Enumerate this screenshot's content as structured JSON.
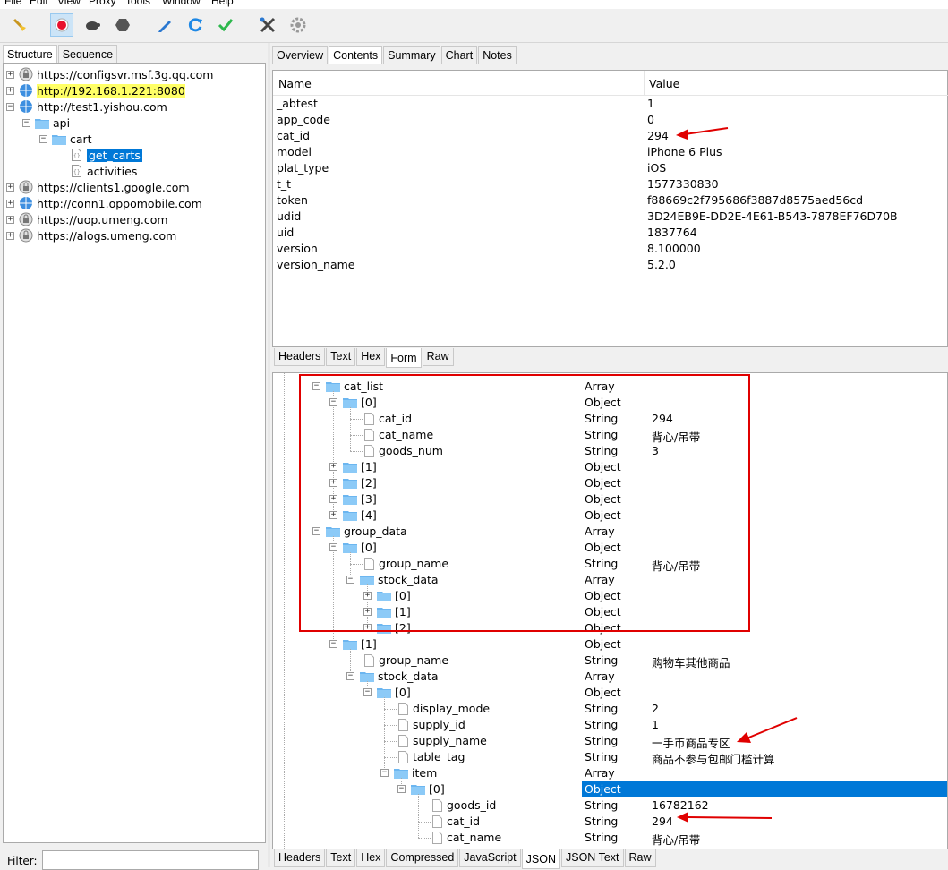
{
  "menu": [
    "File",
    "Edit",
    "View",
    "Proxy",
    "Tools",
    "Window",
    "Help"
  ],
  "left_tabs": [
    "Structure",
    "Sequence"
  ],
  "tree": [
    {
      "label": "https://configsvr.msf.3g.qq.com",
      "type": "lock"
    },
    {
      "label": "http://192.168.1.221:8080",
      "type": "http",
      "highlight": true
    },
    {
      "label": "http://test1.yishou.com",
      "type": "http"
    },
    {
      "label": "api",
      "type": "folder"
    },
    {
      "label": "cart",
      "type": "folder"
    },
    {
      "label": "get_carts",
      "type": "doc",
      "selected": true
    },
    {
      "label": "activities",
      "type": "doc"
    },
    {
      "label": "https://clients1.google.com",
      "type": "lock"
    },
    {
      "label": "http://conn1.oppomobile.com",
      "type": "http"
    },
    {
      "label": "https://uop.umeng.com",
      "type": "lock"
    },
    {
      "label": "https://alogs.umeng.com",
      "type": "lock"
    }
  ],
  "filter_label": "Filter:",
  "top_tabs": [
    "Overview",
    "Contents",
    "Summary",
    "Chart",
    "Notes"
  ],
  "grid": {
    "headers": [
      "Name",
      "Value"
    ],
    "rows": [
      [
        "_abtest",
        "1"
      ],
      [
        "app_code",
        "0"
      ],
      [
        "cat_id",
        "294"
      ],
      [
        "model",
        "iPhone 6 Plus"
      ],
      [
        "plat_type",
        "iOS"
      ],
      [
        "t_t",
        "1577330830"
      ],
      [
        "token",
        "f88669c2f795686f3887d8575aed56cd"
      ],
      [
        "udid",
        "3D24EB9E-DD2E-4E61-B543-7878EF76D70B"
      ],
      [
        "uid",
        "1837764"
      ],
      [
        "version",
        "8.100000"
      ],
      [
        "version_name",
        "5.2.0"
      ]
    ]
  },
  "mid_tabs": [
    "Headers",
    "Text",
    "Hex",
    "Form",
    "Raw"
  ],
  "json_rows": [
    {
      "name": "cat_list",
      "type": "Array",
      "value": ""
    },
    {
      "name": "[0]",
      "type": "Object",
      "value": ""
    },
    {
      "name": "cat_id",
      "type": "String",
      "value": "294"
    },
    {
      "name": "cat_name",
      "type": "String",
      "value": "背心/吊带"
    },
    {
      "name": "goods_num",
      "type": "String",
      "value": "3"
    },
    {
      "name": "[1]",
      "type": "Object",
      "value": ""
    },
    {
      "name": "[2]",
      "type": "Object",
      "value": ""
    },
    {
      "name": "[3]",
      "type": "Object",
      "value": ""
    },
    {
      "name": "[4]",
      "type": "Object",
      "value": ""
    },
    {
      "name": "group_data",
      "type": "Array",
      "value": ""
    },
    {
      "name": "[0]",
      "type": "Object",
      "value": ""
    },
    {
      "name": "group_name",
      "type": "String",
      "value": "背心/吊带"
    },
    {
      "name": "stock_data",
      "type": "Array",
      "value": ""
    },
    {
      "name": "[0]",
      "type": "Object",
      "value": ""
    },
    {
      "name": "[1]",
      "type": "Object",
      "value": ""
    },
    {
      "name": "[2]",
      "type": "Object",
      "value": ""
    },
    {
      "name": "[1]",
      "type": "Object",
      "value": ""
    },
    {
      "name": "group_name",
      "type": "String",
      "value": "购物车其他商品"
    },
    {
      "name": "stock_data",
      "type": "Array",
      "value": ""
    },
    {
      "name": "[0]",
      "type": "Object",
      "value": ""
    },
    {
      "name": "display_mode",
      "type": "String",
      "value": "2"
    },
    {
      "name": "supply_id",
      "type": "String",
      "value": "1"
    },
    {
      "name": "supply_name",
      "type": "String",
      "value": "一手币商品专区"
    },
    {
      "name": "table_tag",
      "type": "String",
      "value": "商品不参与包邮门槛计算"
    },
    {
      "name": "item",
      "type": "Array",
      "value": ""
    },
    {
      "name": "[0]",
      "type": "Object",
      "value": ""
    },
    {
      "name": "goods_id",
      "type": "String",
      "value": "16782162"
    },
    {
      "name": "cat_id",
      "type": "String",
      "value": "294"
    },
    {
      "name": "cat_name",
      "type": "String",
      "value": "背心/吊带"
    }
  ],
  "bottom_tabs": [
    "Headers",
    "Text",
    "Hex",
    "Compressed",
    "JavaScript",
    "JSON",
    "JSON Text",
    "Raw"
  ],
  "colors": {
    "accent": "#0078d7",
    "annotation": "#e00000",
    "highlight": "#ffff66"
  }
}
